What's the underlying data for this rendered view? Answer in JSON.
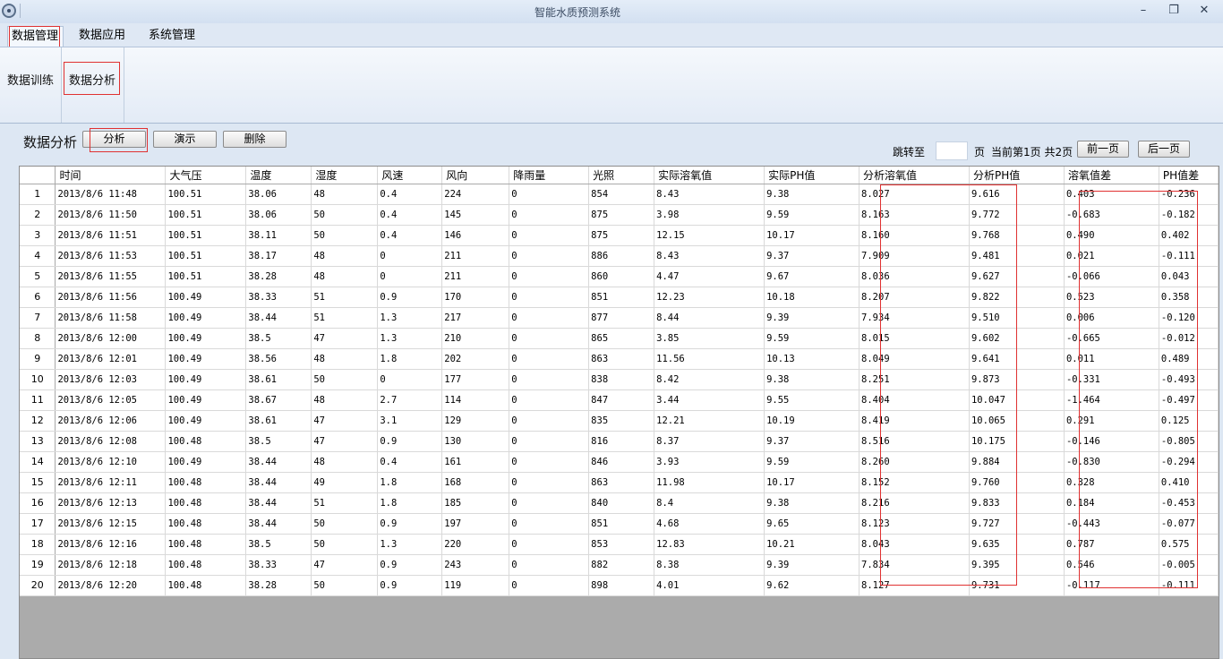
{
  "window": {
    "title": "智能水质预测系统",
    "minimize": "–",
    "maximize": "❐",
    "close": "✕"
  },
  "tabs": [
    {
      "label": "数据管理",
      "active": true
    },
    {
      "label": "数据应用",
      "active": false
    },
    {
      "label": "系统管理",
      "active": false
    }
  ],
  "ribbon": {
    "items": [
      {
        "label": "数据训练"
      },
      {
        "label": "数据分析"
      }
    ]
  },
  "section": {
    "title": "数据分析"
  },
  "toolbar": {
    "analyze_label": "分析",
    "demo_label": "演示",
    "delete_label": "删除"
  },
  "pager": {
    "jump_label": "跳转至",
    "page_unit": "页",
    "page_input": "",
    "status": "当前第1页 共2页",
    "prev_label": "前一页",
    "next_label": "后一页"
  },
  "table": {
    "columns": [
      "",
      "时间",
      "大气压",
      "温度",
      "湿度",
      "风速",
      "风向",
      "降雨量",
      "光照",
      "实际溶氧值",
      "实际PH值",
      "分析溶氧值",
      "分析PH值",
      "溶氧值差",
      "PH值差"
    ],
    "rows": [
      [
        "1",
        "2013/8/6 11:48",
        "100.51",
        "38.06",
        "48",
        "0.4",
        "224",
        "0",
        "854",
        "8.43",
        "9.38",
        "8.027",
        "9.616",
        "0.403",
        "-0.236"
      ],
      [
        "2",
        "2013/8/6 11:50",
        "100.51",
        "38.06",
        "50",
        "0.4",
        "145",
        "0",
        "875",
        "3.98",
        "9.59",
        "8.163",
        "9.772",
        "-0.683",
        "-0.182"
      ],
      [
        "3",
        "2013/8/6 11:51",
        "100.51",
        "38.11",
        "50",
        "0.4",
        "146",
        "0",
        "875",
        "12.15",
        "10.17",
        "8.160",
        "9.768",
        "0.490",
        "0.402"
      ],
      [
        "4",
        "2013/8/6 11:53",
        "100.51",
        "38.17",
        "48",
        "0",
        "211",
        "0",
        "886",
        "8.43",
        "9.37",
        "7.909",
        "9.481",
        "0.021",
        "-0.111"
      ],
      [
        "5",
        "2013/8/6 11:55",
        "100.51",
        "38.28",
        "48",
        "0",
        "211",
        "0",
        "860",
        "4.47",
        "9.67",
        "8.036",
        "9.627",
        "-0.066",
        "0.043"
      ],
      [
        "6",
        "2013/8/6 11:56",
        "100.49",
        "38.33",
        "51",
        "0.9",
        "170",
        "0",
        "851",
        "12.23",
        "10.18",
        "8.207",
        "9.822",
        "0.523",
        "0.358"
      ],
      [
        "7",
        "2013/8/6 11:58",
        "100.49",
        "38.44",
        "51",
        "1.3",
        "217",
        "0",
        "877",
        "8.44",
        "9.39",
        "7.934",
        "9.510",
        "0.006",
        "-0.120"
      ],
      [
        "8",
        "2013/8/6 12:00",
        "100.49",
        "38.5",
        "47",
        "1.3",
        "210",
        "0",
        "865",
        "3.85",
        "9.59",
        "8.015",
        "9.602",
        "-0.665",
        "-0.012"
      ],
      [
        "9",
        "2013/8/6 12:01",
        "100.49",
        "38.56",
        "48",
        "1.8",
        "202",
        "0",
        "863",
        "11.56",
        "10.13",
        "8.049",
        "9.641",
        "0.011",
        "0.489"
      ],
      [
        "10",
        "2013/8/6 12:03",
        "100.49",
        "38.61",
        "50",
        "0",
        "177",
        "0",
        "838",
        "8.42",
        "9.38",
        "8.251",
        "9.873",
        "-0.331",
        "-0.493"
      ],
      [
        "11",
        "2013/8/6 12:05",
        "100.49",
        "38.67",
        "48",
        "2.7",
        "114",
        "0",
        "847",
        "3.44",
        "9.55",
        "8.404",
        "10.047",
        "-1.464",
        "-0.497"
      ],
      [
        "12",
        "2013/8/6 12:06",
        "100.49",
        "38.61",
        "47",
        "3.1",
        "129",
        "0",
        "835",
        "12.21",
        "10.19",
        "8.419",
        "10.065",
        "0.291",
        "0.125"
      ],
      [
        "13",
        "2013/8/6 12:08",
        "100.48",
        "38.5",
        "47",
        "0.9",
        "130",
        "0",
        "816",
        "8.37",
        "9.37",
        "8.516",
        "10.175",
        "-0.146",
        "-0.805"
      ],
      [
        "14",
        "2013/8/6 12:10",
        "100.49",
        "38.44",
        "48",
        "0.4",
        "161",
        "0",
        "846",
        "3.93",
        "9.59",
        "8.260",
        "9.884",
        "-0.830",
        "-0.294"
      ],
      [
        "15",
        "2013/8/6 12:11",
        "100.48",
        "38.44",
        "49",
        "1.8",
        "168",
        "0",
        "863",
        "11.98",
        "10.17",
        "8.152",
        "9.760",
        "0.328",
        "0.410"
      ],
      [
        "16",
        "2013/8/6 12:13",
        "100.48",
        "38.44",
        "51",
        "1.8",
        "185",
        "0",
        "840",
        "8.4",
        "9.38",
        "8.216",
        "9.833",
        "0.184",
        "-0.453"
      ],
      [
        "17",
        "2013/8/6 12:15",
        "100.48",
        "38.44",
        "50",
        "0.9",
        "197",
        "0",
        "851",
        "4.68",
        "9.65",
        "8.123",
        "9.727",
        "-0.443",
        "-0.077"
      ],
      [
        "18",
        "2013/8/6 12:16",
        "100.48",
        "38.5",
        "50",
        "1.3",
        "220",
        "0",
        "853",
        "12.83",
        "10.21",
        "8.043",
        "9.635",
        "0.787",
        "0.575"
      ],
      [
        "19",
        "2013/8/6 12:18",
        "100.48",
        "38.33",
        "47",
        "0.9",
        "243",
        "0",
        "882",
        "8.38",
        "9.39",
        "7.834",
        "9.395",
        "0.546",
        "-0.005"
      ],
      [
        "20",
        "2013/8/6 12:20",
        "100.48",
        "38.28",
        "50",
        "0.9",
        "119",
        "0",
        "898",
        "4.01",
        "9.62",
        "8.127",
        "9.731",
        "-0.117",
        "-0.111"
      ]
    ]
  }
}
